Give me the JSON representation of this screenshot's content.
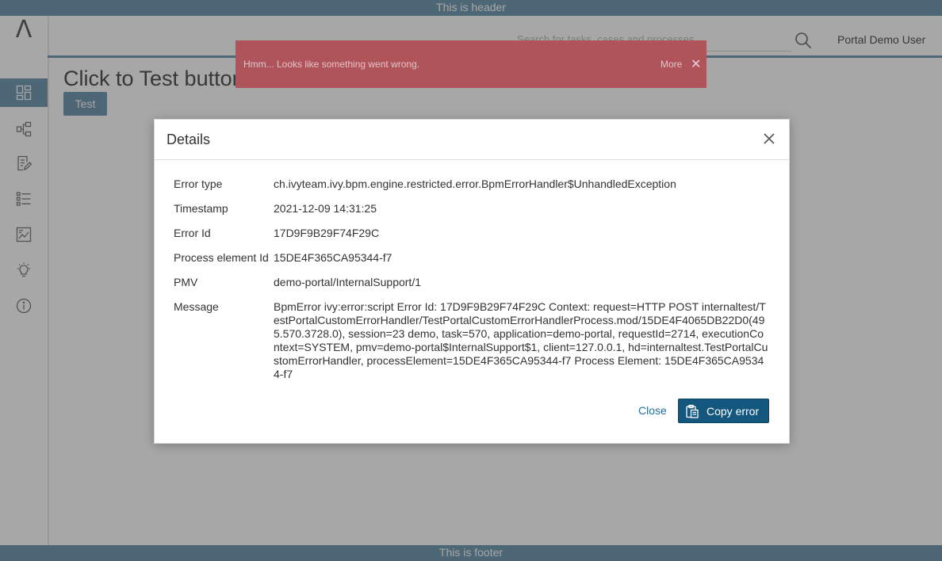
{
  "header": {
    "text": "This is header"
  },
  "footer": {
    "text": "This is footer"
  },
  "sidebar": {
    "logo": "Λ",
    "items": [
      {
        "icon": "dashboard-icon",
        "active": true
      },
      {
        "icon": "processes-icon",
        "active": false
      },
      {
        "icon": "tasks-icon",
        "active": false
      },
      {
        "icon": "cases-icon",
        "active": false
      },
      {
        "icon": "statistics-icon",
        "active": false
      },
      {
        "icon": "idea-icon",
        "active": false
      },
      {
        "icon": "info-icon",
        "active": false
      }
    ]
  },
  "topbar": {
    "search_placeholder": "Search for tasks, cases and processes",
    "user_name": "Portal Demo User"
  },
  "page": {
    "title": "Click to Test button",
    "test_button": "Test"
  },
  "toast": {
    "message": "Hmm... Looks like something went wrong.",
    "more": "More",
    "close": "✕"
  },
  "dialog": {
    "title": "Details",
    "rows": [
      {
        "label": "Error type",
        "value": "ch.ivyteam.ivy.bpm.engine.restricted.error.BpmErrorHandler$UnhandledException"
      },
      {
        "label": "Timestamp",
        "value": "2021-12-09 14:31:25"
      },
      {
        "label": "Error Id",
        "value": "17D9F9B29F74F29C"
      },
      {
        "label": "Process element Id",
        "value": "15DE4F365CA95344-f7"
      },
      {
        "label": "PMV",
        "value": "demo-portal/InternalSupport/1"
      },
      {
        "label": "Message",
        "value": "BpmError ivy:error:script Error Id: 17D9F9B29F74F29C Context: request=HTTP POST internaltest/TestPortalCustomErrorHandler/TestPortalCustomErrorHandlerProcess.mod/15DE4F4065DB22D0(495.570.3728.0), session=23 demo, task=570, application=demo-portal, requestId=2714, executionContext=SYSTEM, pmv=demo-portal$InternalSupport$1, client=127.0.0.1, hd=internaltest.TestPortalCustomErrorHandler, processElement=15DE4F365CA95344-f7 Process Element: 15DE4F365CA95344-f7"
      }
    ],
    "close_label": "Close",
    "copy_label": "Copy error"
  },
  "colors": {
    "accent": "#5c8aa6",
    "primary_button": "#13577f",
    "toast": "#b0545c"
  }
}
